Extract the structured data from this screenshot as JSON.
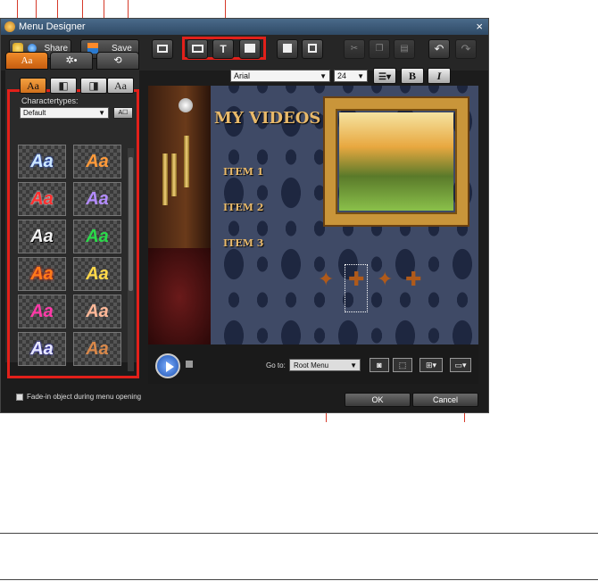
{
  "window": {
    "title": "Menu Designer",
    "close": "×"
  },
  "toolbar": {
    "share_label": "Share",
    "save_label": "Save"
  },
  "tabs": [
    {
      "icon": "text-style-icon",
      "label": "Aa"
    },
    {
      "icon": "particle-effect-icon"
    },
    {
      "icon": "menu-transition-icon"
    }
  ],
  "style_buttons": [
    "Aa",
    "◧",
    "◨",
    "Aa"
  ],
  "character_types": {
    "label": "Charactertypes:",
    "value": "Default"
  },
  "presets": [
    {
      "text": "Aa",
      "color": "#cfe8ff"
    },
    {
      "text": "Aa",
      "color": "#ff9a3a"
    },
    {
      "text": "Aa",
      "color": "#ff3030"
    },
    {
      "text": "Aa",
      "color": "#b38cff"
    },
    {
      "text": "Aa",
      "color": "#f0f0f0"
    },
    {
      "text": "Aa",
      "color": "#2bd94a"
    },
    {
      "text": "Aa",
      "color": "#ff7a1a"
    },
    {
      "text": "Aa",
      "color": "#ffd84a"
    },
    {
      "text": "Aa",
      "color": "#ff3aa8"
    },
    {
      "text": "Aa",
      "color": "#ffb898"
    },
    {
      "text": "Aa",
      "color": "#e8e8ff"
    },
    {
      "text": "Aa",
      "color": "#d9884a"
    }
  ],
  "font": {
    "family": "Arial",
    "size": "24",
    "bold": "B",
    "italic": "I"
  },
  "canvas": {
    "title": "MY VIDEOS",
    "items": [
      "ITEM 1",
      "ITEM 2",
      "ITEM 3"
    ]
  },
  "playback": {
    "goto_label": "Go to:",
    "goto_value": "Root Menu"
  },
  "fade": {
    "label": "Fade-in object during menu opening"
  },
  "buttons": {
    "ok": "OK",
    "cancel": "Cancel"
  }
}
